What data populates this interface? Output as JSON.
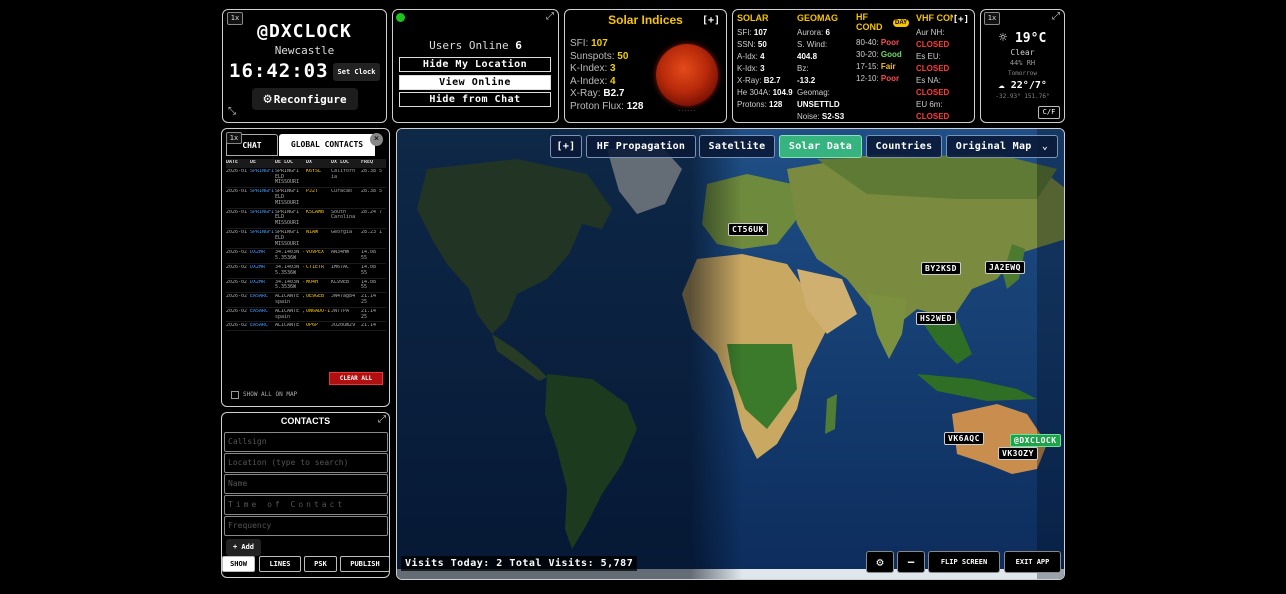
{
  "clock": {
    "callsign": "@DXCLOCK",
    "location": "Newcastle",
    "time": "16:42:03",
    "set_clock_label": "Set Clock",
    "reconfigure_label": "Reconfigure",
    "corner_badge": "1x"
  },
  "users": {
    "online_label": "Users Online",
    "online_count": "6",
    "hide_location_label": "Hide My Location",
    "view_online_label": "View Online",
    "hide_chat_label": "Hide from Chat"
  },
  "solar_indices": {
    "title": "Solar Indices",
    "expand_label": "[+]",
    "rows": [
      {
        "label": "SFI:",
        "value": "107"
      },
      {
        "label": "Sunspots:",
        "value": "50"
      },
      {
        "label": "K-Index:",
        "value": "3"
      },
      {
        "label": "A-Index:",
        "value": "4"
      },
      {
        "label": "X-Ray:",
        "value": "B2.7"
      },
      {
        "label": "Proton Flux:",
        "value": "128"
      }
    ],
    "sun_caption": "------"
  },
  "conditions": {
    "expand_label": "[+]",
    "solar_header": "SOLAR",
    "solar_rows": [
      {
        "label": "SFI:",
        "value": "107"
      },
      {
        "label": "SSN:",
        "value": "50"
      },
      {
        "label": "A-Idx:",
        "value": "4"
      },
      {
        "label": "K-Idx:",
        "value": "3"
      },
      {
        "label": "X-Ray:",
        "value": "B2.7"
      },
      {
        "label": "He 304A:",
        "value": "104.9"
      },
      {
        "label": "Protons:",
        "value": "128"
      }
    ],
    "geomag_header": "GEOMAG",
    "geomag_rows": [
      {
        "label": "Aurora:",
        "value": "6"
      },
      {
        "label": "S. Wind:",
        "value": "404.8"
      },
      {
        "label": "Bz:",
        "value": "-13.2"
      },
      {
        "label": "Geomag:",
        "value": "UNSETTLD"
      },
      {
        "label": "Noise:",
        "value": "S2-S3"
      }
    ],
    "hf_header_1": "HF",
    "hf_header_2": "COND",
    "day_badge": "DAY",
    "hf_rows": [
      {
        "band": "80-40:",
        "value": "Poor",
        "cls": "poor"
      },
      {
        "band": "30-20:",
        "value": "Good",
        "cls": "good"
      },
      {
        "band": "17-15:",
        "value": "Fair",
        "cls": "fair"
      },
      {
        "band": "12-10:",
        "value": "Poor",
        "cls": "poor"
      }
    ],
    "vhf_header": "VHF CON",
    "vhf_rows": [
      {
        "label": "Aur NH:",
        "value": "CLOSED"
      },
      {
        "label": "Es EU:",
        "value": "CLOSED"
      },
      {
        "label": "Es NA:",
        "value": "CLOSED"
      },
      {
        "label": "EU 6m:",
        "value": "CLOSED"
      }
    ]
  },
  "weather": {
    "corner_badge": "1x",
    "temp": "19°C",
    "condition": "Clear",
    "detail": "44% RH",
    "tomorrow_label": "Tomorrow",
    "tomorrow_temps": "22°/7°",
    "coords": "-32.93° 151.76°",
    "unit_toggle": "C/F"
  },
  "chat": {
    "corner_badge": "1x",
    "tab_chat": "CHAT",
    "tab_global": "GLOBAL CONTACTS",
    "columns": [
      "DATE",
      "DE",
      "DE LOC",
      "DX",
      "DX LOC",
      "FREQ"
    ],
    "rows": [
      [
        "2026-01",
        "SPRINGFI",
        "SPRINGFI ELD MISSOURI",
        "K6YSL",
        "Californ ia",
        "28.38 5"
      ],
      [
        "2026-01",
        "SPRINGFI",
        "SPRINGFI ELD MISSOURI",
        "PJ2T",
        "Curacao",
        "28.38 5"
      ],
      [
        "2026-01",
        "SPRINGFI",
        "SPRINGFI ELD MISSOURI",
        "K5LAMB",
        "South Carolina",
        "28.24 7"
      ],
      [
        "2026-01",
        "SPRINGFI",
        "SPRINGFI ELD MISSOURI",
        "N1AW",
        "Georgia",
        "28.23 1"
      ],
      [
        "2026-02",
        "DX2MR",
        "34.1403N - 5.3536W",
        "VO9PEX",
        "AN34HW",
        "14.08 55"
      ],
      [
        "2026-02",
        "DX2MR",
        "34.1403N - 5.3536W",
        "CT1ETR",
        "IM67AC",
        "14.08 55"
      ],
      [
        "2026-02",
        "DX2MR",
        "34.1403N - 5.3536W",
        "MO4H",
        "KL99EB",
        "14.08 55"
      ],
      [
        "2026-02",
        "EA5ARC",
        "ALICANTE , spain",
        "OE9GEB",
        "JN47ag84",
        "21.14 25"
      ],
      [
        "2026-02",
        "EA5ARC",
        "ALICANTE , spain",
        "UN6ADO-1",
        "JN77PA",
        "21.14 25"
      ],
      [
        "2026-02",
        "EA5ARC",
        "ALICANTE",
        "OP6P",
        "JO20um29",
        "21.14"
      ]
    ],
    "clear_all_label": "CLEAR ALL",
    "show_all_label": "SHOW ALL ON MAP"
  },
  "contacts": {
    "title": "CONTACTS",
    "callsign_placeholder": "Callsign",
    "location_placeholder": "Location (type to search)",
    "name_placeholder": "Name",
    "time_placeholder": "Time of Contact",
    "frequency_placeholder": "Frequency",
    "add_label": "+ Add",
    "show_label": "SHOW",
    "lines_label": "LINES",
    "psk_label": "PSK",
    "publish_label": "PUBLISH"
  },
  "map": {
    "expand_label": "[+]",
    "tabs": [
      "HF Propagation",
      "Satellite",
      "Solar Data",
      "Countries"
    ],
    "map_select": "Original Map",
    "callsigns": [
      "CT56UK",
      "BY2KSD",
      "JA2EWQ",
      "HS2WED",
      "VK6AQC",
      "VK3OZY"
    ],
    "home_callsign": "@DXCLOCK",
    "visits": "Visits Today: 2 Total Visits: 5,787",
    "flip_label": "FLIP SCREEN",
    "exit_label": "EXIT APP",
    "colors": {
      "accent": "#36b37e",
      "tab_bg": "#0a1937"
    }
  }
}
